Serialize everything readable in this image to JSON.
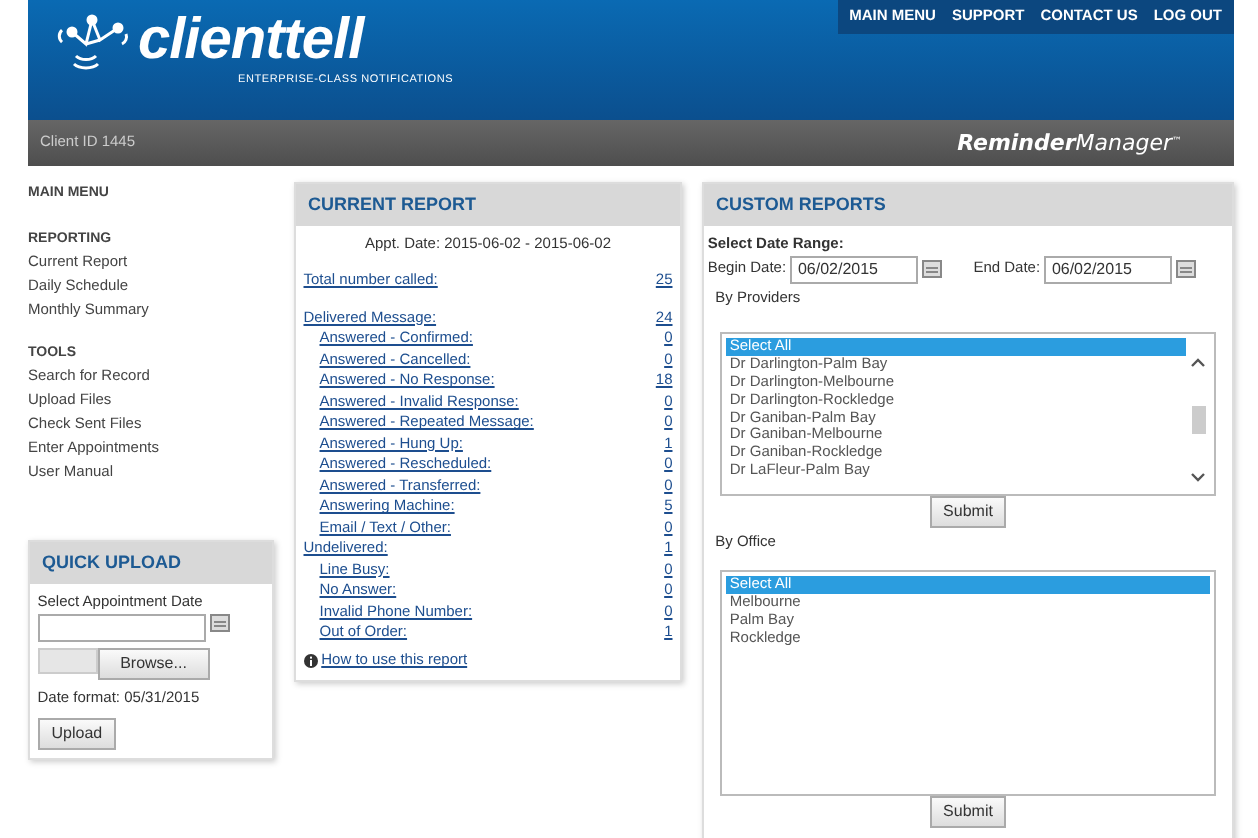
{
  "header": {
    "logo": "clienttell",
    "tagline": "ENTERPRISE-CLASS NOTIFICATIONS",
    "nav": [
      "MAIN MENU",
      "SUPPORT",
      "CONTACT US",
      "LOG OUT"
    ],
    "client_id": "Client ID 1445",
    "product": "**Reminder**Manager$^{™}$"
  },
  "sidebar": {
    "title": "MAIN MENU",
    "sections": [
      {
        "heading": "REPORTING",
        "items": [
          "Current Report",
          "Daily Schedule",
          "Monthly Summary"
        ]
      },
      {
        "heading": "TOOLS",
        "items": [
          "Search for Record",
          "Upload Files",
          "Check Sent Files",
          "Enter Appointments",
          "User Manual"
        ]
      }
    ]
  },
  "quick_upload": {
    "title": "QUICK UPLOAD",
    "date_label": "Select Appointment Date",
    "browse": "Browse...",
    "date_format": "Date format: 05/31/2015",
    "button": "Upload"
  },
  "current_report": {
    "title": "CURRENT REPORT",
    "appt_date": "Appt. Date: 2015-06-02 - 2015-06-02",
    "rows": [
      {
        "label": "Total number called:",
        "value": "25"
      },
      {
        "label": "Delivered Message:",
        "value": "24",
        "children": [
          {
            "label": "Answered - Confirmed:",
            "value": "0"
          },
          {
            "label": "Answered - Cancelled:",
            "value": "0"
          },
          {
            "label": "Answered - No Response:",
            "value": "18"
          },
          {
            "label": "Answered - Invalid Response:",
            "value": "0"
          },
          {
            "label": "Answered - Repeated Message:",
            "value": "0"
          },
          {
            "label": "Answered - Hung Up:",
            "value": "1"
          },
          {
            "label": "Answered - Rescheduled:",
            "value": "0"
          },
          {
            "label": "Answered - Transferred:",
            "value": "0"
          },
          {
            "label": "Answering Machine:",
            "value": "5"
          },
          {
            "label": "Email / Text / Other:",
            "value": "0"
          }
        ]
      },
      {
        "label": "Undelivered:",
        "value": "1",
        "children": [
          {
            "label": "Line Busy:",
            "value": "0"
          },
          {
            "label": "No Answer:",
            "value": "0"
          },
          {
            "label": "Invalid Phone Number:",
            "value": "0"
          },
          {
            "label": "Out of Order:",
            "value": "1"
          }
        ]
      }
    ],
    "help_link": "How to use this report"
  },
  "custom_reports": {
    "title": "CUSTOM REPORTS",
    "range_label": "Select Date Range:",
    "begin_label": "Begin Date:",
    "begin_value": "06/02/2015",
    "end_label": "End Date:",
    "end_value": "06/02/2015",
    "lists": [
      {
        "label": "By Providers",
        "scrollbar": true,
        "options": [
          {
            "text": "Select All",
            "selected": true
          },
          {
            "text": "Dr Darlington-Palm Bay",
            "selected": false
          },
          {
            "text": "Dr Darlington-Melbourne",
            "selected": false
          },
          {
            "text": "Dr Darlington-Rockledge",
            "selected": false
          },
          {
            "text": "Dr Ganiban-Palm Bay",
            "selected": false
          },
          {
            "text": "Dr Ganiban-Melbourne",
            "selected": false
          },
          {
            "text": "Dr Ganiban-Rockledge",
            "selected": false
          },
          {
            "text": "Dr LaFleur-Palm Bay",
            "selected": false
          }
        ],
        "button": "Submit"
      },
      {
        "label": "By Office",
        "scrollbar": false,
        "options": [
          {
            "text": "Select All",
            "selected": true
          },
          {
            "text": "Melbourne",
            "selected": false
          },
          {
            "text": "Palm Bay",
            "selected": false
          },
          {
            "text": "Rockledge",
            "selected": false
          }
        ],
        "button": "Submit"
      }
    ]
  }
}
